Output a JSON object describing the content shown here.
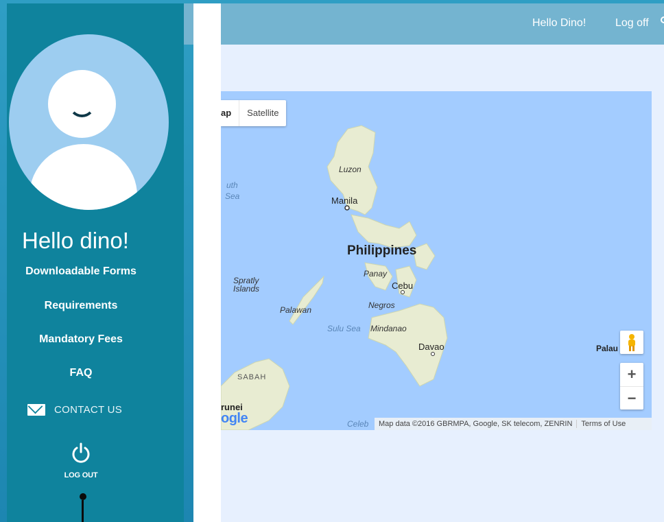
{
  "sidebar": {
    "greeting": "Hello dino!",
    "nav": [
      {
        "label": "Downloadable Forms"
      },
      {
        "label": "Requirements"
      },
      {
        "label": "Mandatory Fees"
      },
      {
        "label": "FAQ"
      }
    ],
    "contact_label": "CONTACT US",
    "logout_label": "LOG OUT"
  },
  "topbar": {
    "greeting": "Hello Dino!",
    "logoff": "Log off"
  },
  "map": {
    "type_buttons": [
      "ap",
      "Satellite"
    ],
    "labels": {
      "luzon": "Luzon",
      "manila": "Manila",
      "philippines": "Philippines",
      "panay": "Panay",
      "cebu": "Cebu",
      "negros": "Negros",
      "mindanao": "Mindanao",
      "davao": "Davao",
      "palawan": "Palawan",
      "sulu_sea": "Sulu Sea",
      "spratly": "Spratly Islands",
      "south_sea_1": "uth",
      "south_sea_2": "Sea",
      "sabah": "SABAH",
      "brunei": "runei",
      "celebes": "Celeb",
      "palau": "Palau"
    },
    "logo_text": "ogle",
    "attribution": "Map data ©2016 GBRMPA, Google, SK telecom, ZENRIN",
    "terms": "Terms of Use",
    "zoom_in": "+",
    "zoom_out": "−"
  },
  "colors": {
    "sidebar": "#0f839d",
    "topbar": "#74b4d0",
    "content": "#e7f0fe",
    "water": "#a3ccff",
    "land": "#e8ecd2"
  }
}
